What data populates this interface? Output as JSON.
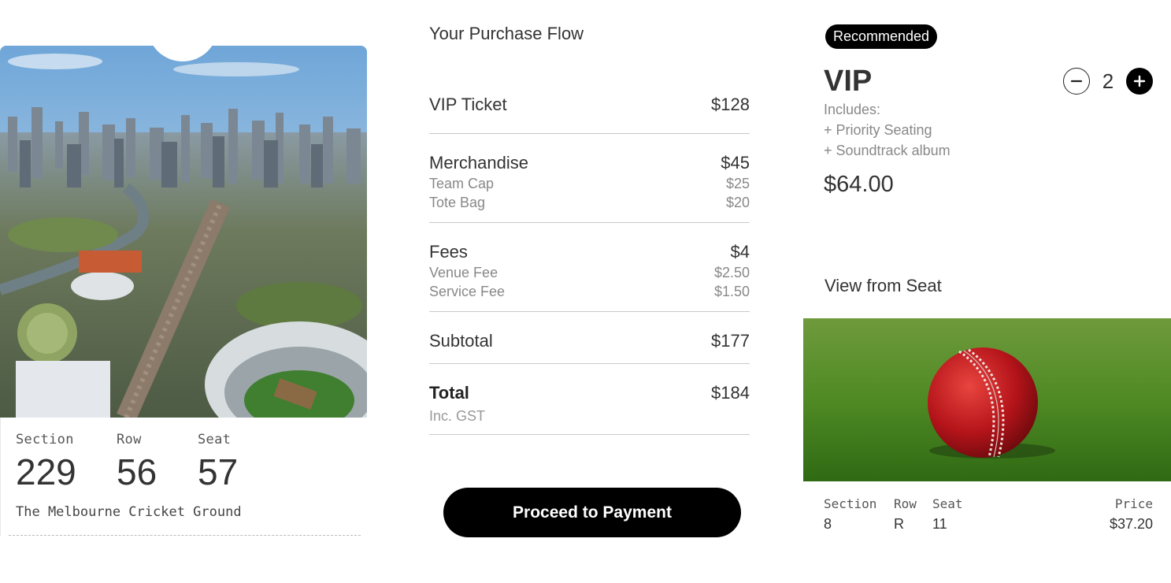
{
  "ticket": {
    "section_label": "Section",
    "section_value": "229",
    "row_label": "Row",
    "row_value": "56",
    "seat_label": "Seat",
    "seat_value": "57",
    "venue": "The Melbourne Cricket Ground"
  },
  "flow": {
    "title": "Your Purchase Flow",
    "vip_ticket": {
      "label": "VIP Ticket",
      "amount": "$128"
    },
    "merchandise": {
      "label": "Merchandise",
      "amount": "$45",
      "items": [
        {
          "label": "Team Cap",
          "amount": "$25"
        },
        {
          "label": "Tote Bag",
          "amount": "$20"
        }
      ]
    },
    "fees": {
      "label": "Fees",
      "amount": "$4",
      "items": [
        {
          "label": "Venue Fee",
          "amount": "$2.50"
        },
        {
          "label": "Service Fee",
          "amount": "$1.50"
        }
      ]
    },
    "subtotal": {
      "label": "Subtotal",
      "amount": "$177"
    },
    "total": {
      "label": "Total",
      "amount": "$184",
      "note": "Inc. GST"
    },
    "cta": "Proceed to Payment"
  },
  "offer": {
    "badge": "Recommended",
    "title": "VIP",
    "includes_label": "Includes:",
    "includes": [
      "+ Priority Seating",
      "+ Soundtrack album"
    ],
    "price": "$64.00",
    "quantity": "2"
  },
  "seat_view": {
    "title": "View from Seat",
    "section_label": "Section",
    "section_value": "8",
    "row_label": "Row",
    "row_value": "R",
    "seat_label": "Seat",
    "seat_value": "11",
    "price_label": "Price",
    "price_value": "$37.20"
  },
  "icons": {
    "minus": "minus-circle-icon",
    "plus": "plus-circle-icon"
  },
  "colors": {
    "accent": "#000000",
    "muted_text": "#888888",
    "divider": "#c9c9c9"
  }
}
